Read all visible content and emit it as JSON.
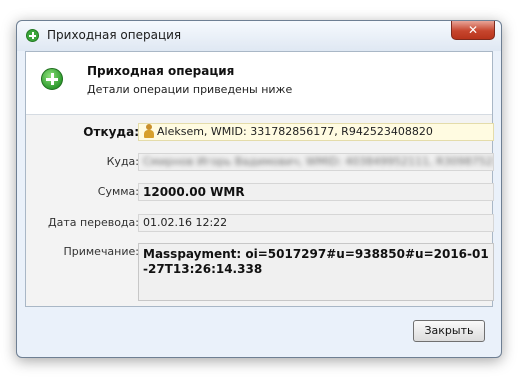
{
  "window": {
    "title": "Приходная операция",
    "close_symbol": "✕",
    "icon": "add-circle-icon"
  },
  "header": {
    "title": "Приходная операция",
    "subtitle": "Детали операции приведены ниже",
    "icon": "add-circle-icon"
  },
  "form": {
    "from": {
      "label": "Откуда:",
      "value": "Aleksem, WMID: 331782856177, R942523408820",
      "icon": "person-icon"
    },
    "to": {
      "label": "Куда:",
      "value": "Смирнов Игорь Вадимович, WMID: 403849952111, R309875211487"
    },
    "amount": {
      "label": "Сумма:",
      "value": "12000.00 WMR"
    },
    "date": {
      "label": "Дата перевода:",
      "value": "01.02.16 12:22"
    },
    "note": {
      "label": "Примечание:",
      "value": "Masspayment: oi=5017297#u=938850#u=2016-01-27T13:26:14.338"
    }
  },
  "footer": {
    "close_label": "Закрыть"
  },
  "colors": {
    "from_field_bg": "#fffbe1",
    "close_button_red": "#c6452d",
    "icon_green": "#2f9c2f"
  }
}
